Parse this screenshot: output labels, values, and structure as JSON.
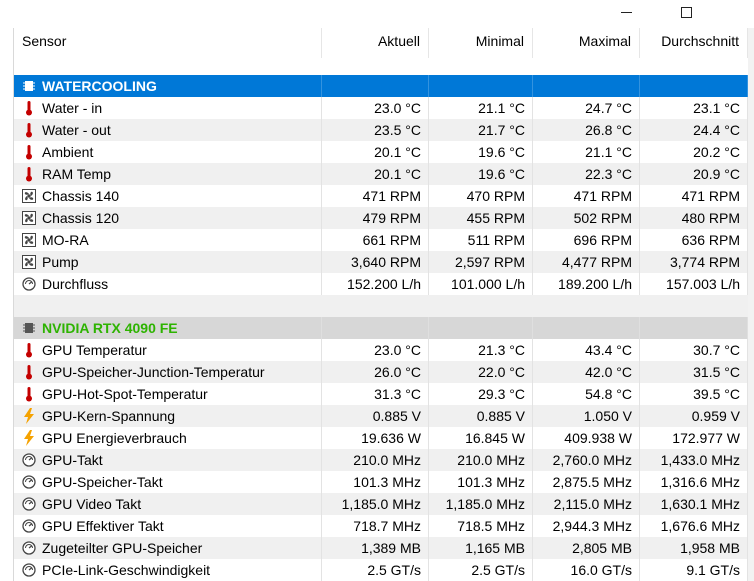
{
  "columns": [
    "Sensor",
    "Aktuell",
    "Minimal",
    "Maximal",
    "Durchschnitt"
  ],
  "groups": [
    {
      "title": "WATERCOOLING",
      "rows": [
        {
          "icon": "thermometer-icon",
          "name": "Water - in",
          "current": "23.0 °C",
          "min": "21.1 °C",
          "max": "24.7 °C",
          "avg": "23.1 °C"
        },
        {
          "icon": "thermometer-icon",
          "name": "Water - out",
          "current": "23.5 °C",
          "min": "21.7 °C",
          "max": "26.8 °C",
          "avg": "24.4 °C"
        },
        {
          "icon": "thermometer-icon",
          "name": "Ambient",
          "current": "20.1 °C",
          "min": "19.6 °C",
          "max": "21.1 °C",
          "avg": "20.2 °C"
        },
        {
          "icon": "thermometer-icon",
          "name": "RAM Temp",
          "current": "20.1 °C",
          "min": "19.6 °C",
          "max": "22.3 °C",
          "avg": "20.9 °C"
        },
        {
          "icon": "fan-icon",
          "name": "Chassis 140",
          "current": "471 RPM",
          "min": "470 RPM",
          "max": "471 RPM",
          "avg": "471 RPM"
        },
        {
          "icon": "fan-icon",
          "name": "Chassis 120",
          "current": "479 RPM",
          "min": "455 RPM",
          "max": "502 RPM",
          "avg": "480 RPM"
        },
        {
          "icon": "fan-icon",
          "name": "MO-RA",
          "current": "661 RPM",
          "min": "511 RPM",
          "max": "696 RPM",
          "avg": "636 RPM"
        },
        {
          "icon": "fan-icon",
          "name": "Pump",
          "current": "3,640 RPM",
          "min": "2,597 RPM",
          "max": "4,477 RPM",
          "avg": "3,774 RPM"
        },
        {
          "icon": "gauge-icon",
          "name": "Durchfluss",
          "current": "152.200 L/h",
          "min": "101.000 L/h",
          "max": "189.200 L/h",
          "avg": "157.003 L/h"
        }
      ]
    },
    {
      "title": "NVIDIA RTX 4090 FE",
      "rows": [
        {
          "icon": "thermometer-icon",
          "name": "GPU Temperatur",
          "current": "23.0 °C",
          "min": "21.3 °C",
          "max": "43.4 °C",
          "avg": "30.7 °C"
        },
        {
          "icon": "thermometer-icon",
          "name": "GPU-Speicher-Junction-Temperatur",
          "current": "26.0 °C",
          "min": "22.0 °C",
          "max": "42.0 °C",
          "avg": "31.5 °C"
        },
        {
          "icon": "thermometer-icon",
          "name": "GPU-Hot-Spot-Temperatur",
          "current": "31.3 °C",
          "min": "29.3 °C",
          "max": "54.8 °C",
          "avg": "39.5 °C"
        },
        {
          "icon": "lightning-icon",
          "name": "GPU-Kern-Spannung",
          "current": "0.885 V",
          "min": "0.885 V",
          "max": "1.050 V",
          "avg": "0.959 V"
        },
        {
          "icon": "lightning-icon",
          "name": "GPU Energieverbrauch",
          "current": "19.636 W",
          "min": "16.845 W",
          "max": "409.938 W",
          "avg": "172.977 W"
        },
        {
          "icon": "gauge-icon",
          "name": "GPU-Takt",
          "current": "210.0 MHz",
          "min": "210.0 MHz",
          "max": "2,760.0 MHz",
          "avg": "1,433.0 MHz"
        },
        {
          "icon": "gauge-icon",
          "name": "GPU-Speicher-Takt",
          "current": "101.3 MHz",
          "min": "101.3 MHz",
          "max": "2,875.5 MHz",
          "avg": "1,316.6 MHz"
        },
        {
          "icon": "gauge-icon",
          "name": "GPU Video Takt",
          "current": "1,185.0 MHz",
          "min": "1,185.0 MHz",
          "max": "2,115.0 MHz",
          "avg": "1,630.1 MHz"
        },
        {
          "icon": "gauge-icon",
          "name": "GPU Effektiver Takt",
          "current": "718.7 MHz",
          "min": "718.5 MHz",
          "max": "2,944.3 MHz",
          "avg": "1,676.6 MHz"
        },
        {
          "icon": "gauge-icon",
          "name": "Zugeteilter GPU-Speicher",
          "current": "1,389 MB",
          "min": "1,165 MB",
          "max": "2,805 MB",
          "avg": "1,958 MB"
        },
        {
          "icon": "gauge-icon",
          "name": "PCIe-Link-Geschwindigkeit",
          "current": "2.5 GT/s",
          "min": "2.5 GT/s",
          "max": "16.0 GT/s",
          "avg": "9.1 GT/s"
        }
      ]
    }
  ],
  "colors": {
    "selected_group": "#0078d7",
    "gpu_group_bg": "#d7d7d7",
    "gpu_title": "#2db300",
    "row_alt": "#f0f0f0"
  }
}
